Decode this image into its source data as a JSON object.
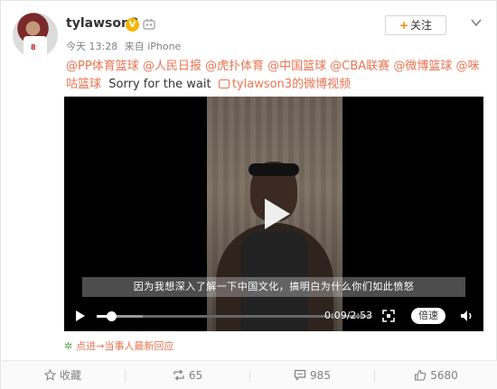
{
  "user": {
    "name": "tylawson3",
    "verified_badge": "V",
    "jersey_number": "8"
  },
  "meta": {
    "time": "今天 13:28",
    "source": "来自 iPhone"
  },
  "follow_label": "关注",
  "post": {
    "mentions": [
      "@PP体育篮球",
      "@人民日报",
      "@虎扑体育",
      "@中国篮球",
      "@CBA联赛",
      "@微博篮球",
      "@咪咕篮球"
    ],
    "text": "Sorry for the wait",
    "video_link": "tylawson3的微博视频"
  },
  "video": {
    "subtitle": "因为我想深入了解一下中国文化，搞明白为什么你们如此愤怒",
    "time": "0:09/2:53",
    "progress": 0.052,
    "speed_label": "倍速"
  },
  "latest_reply": "点进→当事人最新回应",
  "actions": {
    "favorite": "收藏",
    "repost": "65",
    "comment": "985",
    "like": "5680"
  },
  "colors": {
    "accent": "#eb7350",
    "orange": "#ff8200",
    "badge": "#f7b500"
  }
}
